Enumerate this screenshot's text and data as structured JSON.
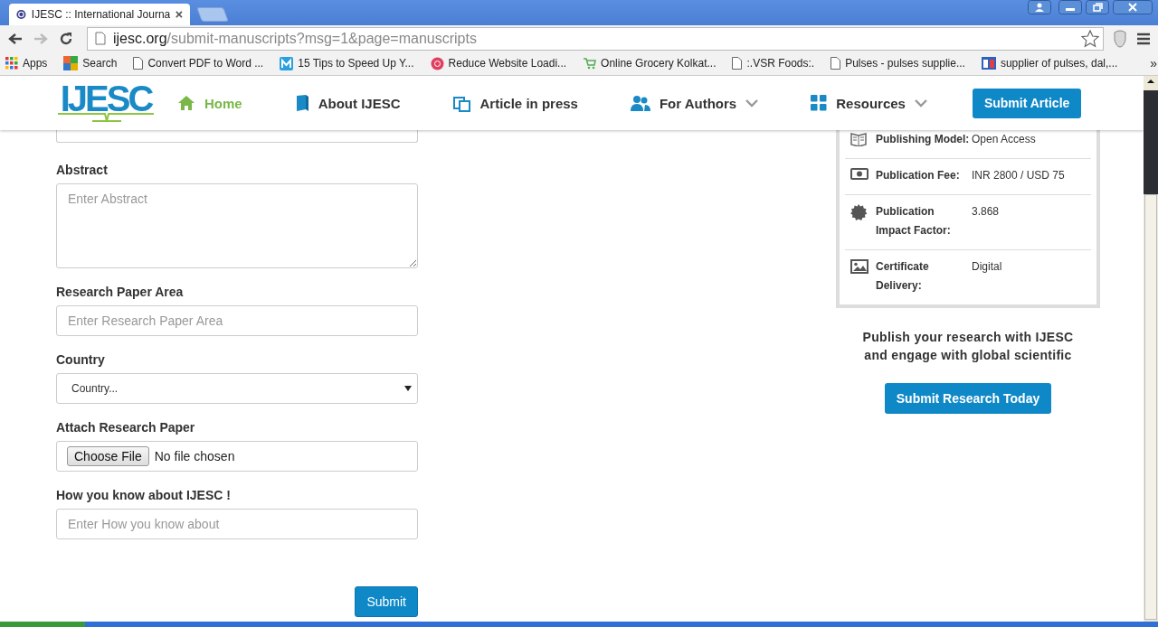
{
  "browser": {
    "tab_title": "IJESC :: International Journa",
    "url_domain": "ijesc.org",
    "url_path": "/submit-manuscripts?msg=1&page=manuscripts",
    "bookmarks": [
      {
        "label": "Apps",
        "kind": "apps"
      },
      {
        "label": "Search",
        "kind": "search"
      },
      {
        "label": "Convert PDF to Word ...",
        "kind": "page"
      },
      {
        "label": "15 Tips to Speed Up Y...",
        "kind": "m"
      },
      {
        "label": "Reduce Website Loadi...",
        "kind": "rk"
      },
      {
        "label": "Online Grocery Kolkat...",
        "kind": "cart"
      },
      {
        "label": ":.VSR Foods:.",
        "kind": "page"
      },
      {
        "label": "Pulses - pulses supplie...",
        "kind": "page"
      },
      {
        "label": "supplier of pulses, dal,...",
        "kind": "grid"
      }
    ],
    "overflow": "»"
  },
  "site": {
    "logo": "IJESC",
    "nav": [
      {
        "label": "Home",
        "selected": true,
        "dropdown": false
      },
      {
        "label": "About IJESC",
        "selected": false,
        "dropdown": false
      },
      {
        "label": "Article in press",
        "selected": false,
        "dropdown": false
      },
      {
        "label": "For Authors",
        "selected": false,
        "dropdown": true
      },
      {
        "label": "Resources",
        "selected": false,
        "dropdown": true
      }
    ],
    "submit_button": "Submit Article"
  },
  "form": {
    "fields": [
      {
        "kind": "cut"
      },
      {
        "kind": "textarea",
        "label": "Abstract",
        "placeholder": "Enter Abstract"
      },
      {
        "kind": "text",
        "label": "Research Paper Area",
        "placeholder": "Enter Research Paper Area"
      },
      {
        "kind": "select",
        "label": "Country",
        "value": "Country..."
      },
      {
        "kind": "file",
        "label": "Attach Research Paper",
        "button": "Choose File",
        "status": "No file chosen"
      },
      {
        "kind": "text",
        "label": "How you know about IJESC !",
        "placeholder": "Enter How you know about"
      }
    ],
    "submit": "Submit"
  },
  "info": {
    "rows": [
      {
        "label": "Publishing Model:",
        "value": "Open Access"
      },
      {
        "label": "Publication Fee:",
        "value": "INR 2800 / USD 75"
      },
      {
        "label": "Publication Impact Factor:",
        "value": "3.868"
      },
      {
        "label": "Certificate Delivery:",
        "value": "Digital"
      }
    ],
    "promo": "Publish your research with IJESC and engage with global scientific",
    "button": "Submit Research Today"
  }
}
